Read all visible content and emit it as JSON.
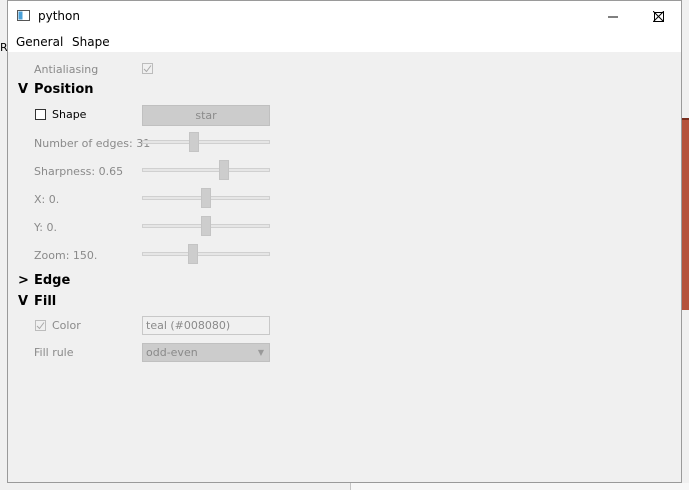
{
  "window": {
    "title": "python",
    "controls": {
      "minimize": "minimize-icon",
      "maximize": "maximize-icon",
      "close": "close-icon"
    }
  },
  "background": {
    "left_fragment_text": "R"
  },
  "menubar": {
    "items": [
      "General",
      "Shape"
    ]
  },
  "antialiasing": {
    "label": "Antialiasing",
    "checked": true
  },
  "position": {
    "toggle": "V",
    "title": "Position",
    "shape_checkbox_label": "Shape",
    "shape_checked": false,
    "shape_button": "star",
    "edges_label": "Number of edges: 31",
    "edges_level": 0.4,
    "sharpness_label": "Sharpness: 0.65",
    "sharpness_level": 0.65,
    "x_label": "X: 0.",
    "x_level": 0.5,
    "y_label": "Y: 0.",
    "y_level": 0.5,
    "zoom_label": "Zoom: 150.",
    "zoom_level": 0.39
  },
  "edge": {
    "toggle": ">",
    "title": "Edge"
  },
  "fill": {
    "toggle": "V",
    "title": "Fill",
    "color_label": "Color",
    "color_checked": true,
    "color_value": "teal (#008080)",
    "fill_rule_label": "Fill rule",
    "fill_rule_value": "odd-even"
  },
  "colors": {
    "accent_background_art": "#b5533c"
  }
}
